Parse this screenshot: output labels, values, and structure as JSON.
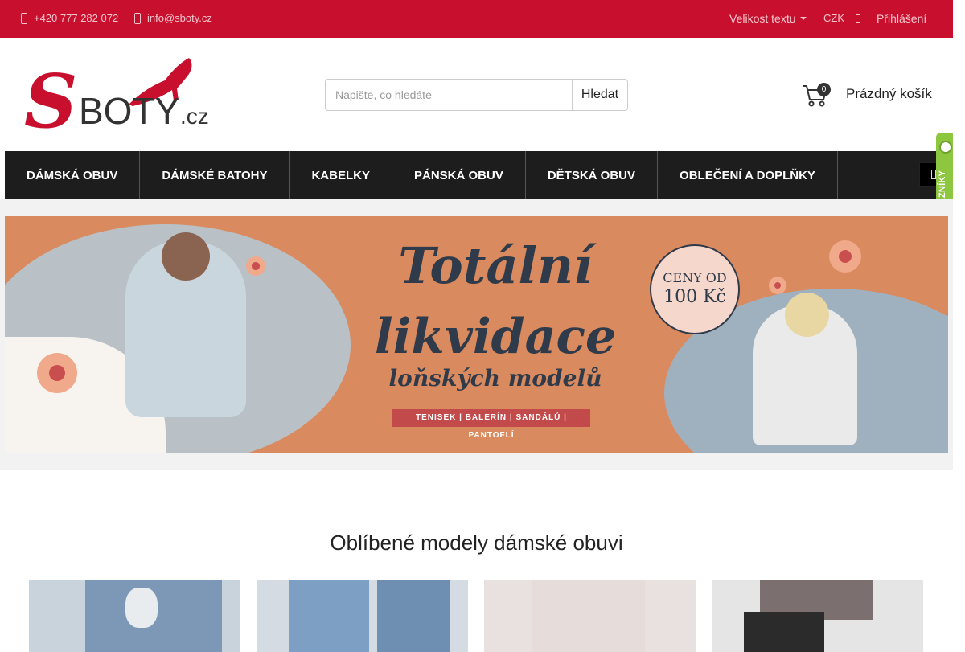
{
  "topbar": {
    "phone": "+420 777 282 072",
    "email": "info@sboty.cz",
    "text_size_label": "Velikost textu",
    "currency": "CZK",
    "login_label": "Přihlášení",
    "background_color": "#c8102e"
  },
  "header": {
    "logo_text_s": "S",
    "logo_text_boty": "BOTY",
    "logo_text_cz": ".cz",
    "search_placeholder": "Napište, co hledáte",
    "search_button": "Hledat",
    "cart_count": "0",
    "cart_label": "Prázdný košík"
  },
  "nav": {
    "items": [
      "DÁMSKÁ OBUV",
      "DÁMSKÉ BATOHY",
      "KABELKY",
      "PÁNSKÁ OBUV",
      "DĚTSKÁ OBUV",
      "OBLEČENÍ A DOPLŇKY"
    ]
  },
  "side_badge": {
    "label": "OVĚŘENO ZÁKAZNÍKY"
  },
  "banner": {
    "title_line1": "Totální",
    "title_line2": "likvidace",
    "title_line3": "loňských modelů",
    "ribbon": "TENISEK | BALERÍN | SANDÁLŮ | PANTOFLÍ",
    "price_line1": "CENY OD",
    "price_line2": "100 Kč"
  },
  "section": {
    "title": "Oblíbené modely dámské obuvi"
  }
}
